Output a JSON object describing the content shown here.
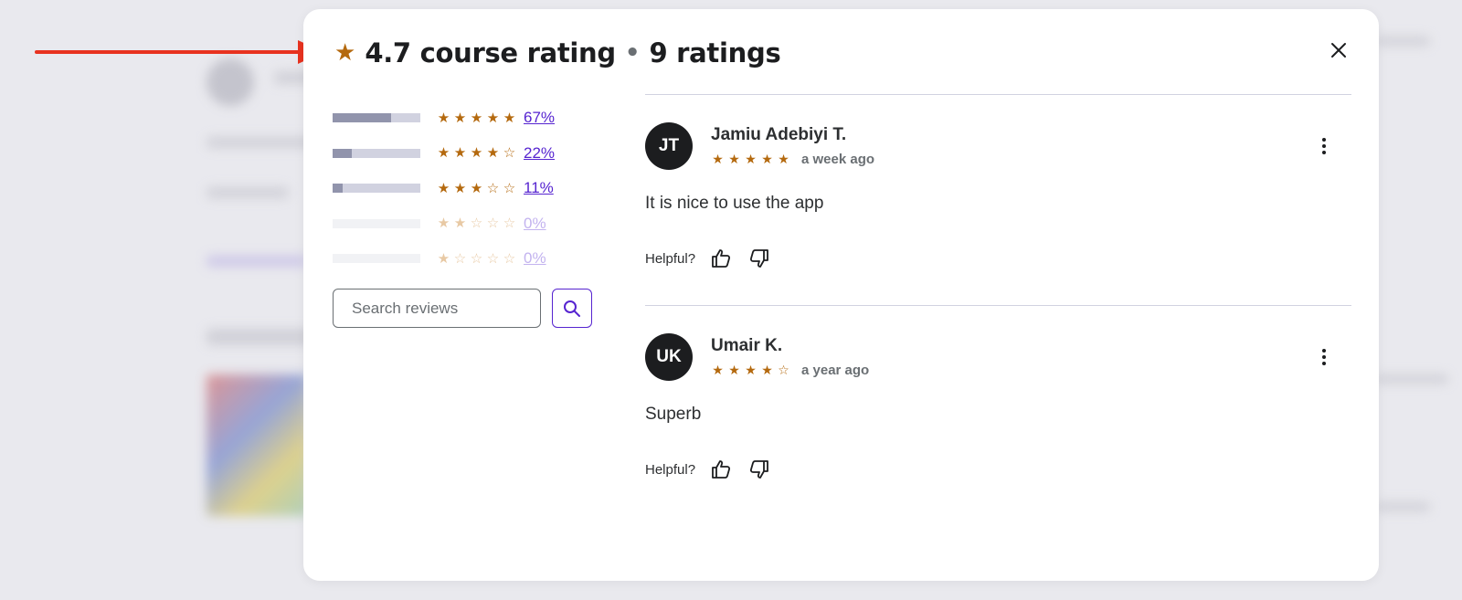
{
  "modal": {
    "rating": "4.7 course rating",
    "separator": "•",
    "count": "9 ratings"
  },
  "breakdown": [
    {
      "stars": 5,
      "fraction": 0.67,
      "pct": "67%"
    },
    {
      "stars": 4,
      "fraction": 0.22,
      "pct": "22%"
    },
    {
      "stars": 3,
      "fraction": 0.11,
      "pct": "11%"
    },
    {
      "stars": 2,
      "fraction": 0,
      "pct": "0%"
    },
    {
      "stars": 1,
      "fraction": 0,
      "pct": "0%"
    }
  ],
  "search": {
    "placeholder": "Search reviews"
  },
  "reviews": [
    {
      "initials": "JT",
      "name": "Jamiu Adebiyi T.",
      "stars": 5,
      "date": "a week ago",
      "text": "It is nice to use the app",
      "helpful": "Helpful?"
    },
    {
      "initials": "UK",
      "name": "Umair K.",
      "stars": 4,
      "date": "a year ago",
      "text": "Superb",
      "helpful": "Helpful?"
    }
  ],
  "colors": {
    "star": "#b4690e",
    "accent": "#5624d0",
    "arrow": "#e8321f"
  }
}
